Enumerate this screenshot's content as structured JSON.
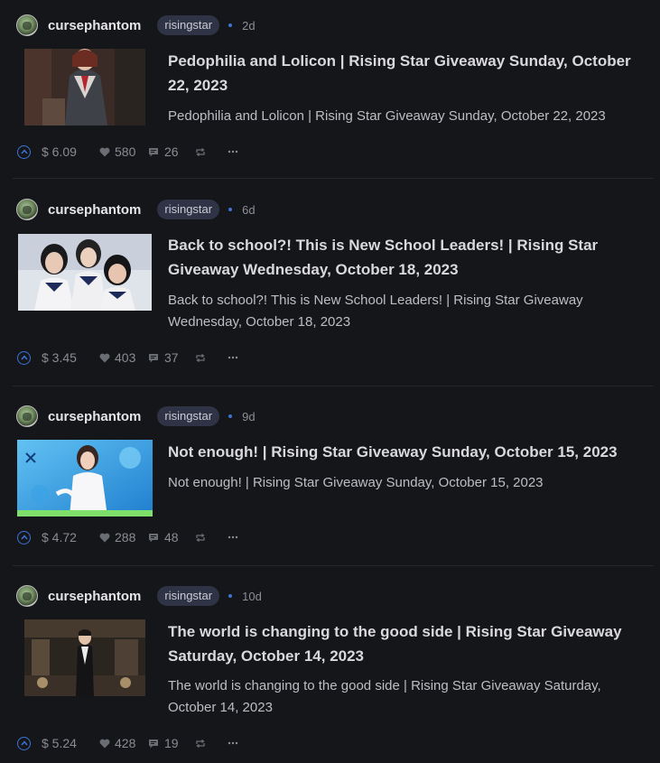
{
  "posts": [
    {
      "author": "cursephantom",
      "community": "risingstar",
      "age": "2d",
      "title": "Pedophilia and Lolicon | Rising Star Giveaway Sunday, October 22, 2023",
      "summary": "Pedophilia and Lolicon | Rising Star Giveaway Sunday, October 22, 2023",
      "payout": "$ 6.09",
      "votes": "580",
      "comments": "26"
    },
    {
      "author": "cursephantom",
      "community": "risingstar",
      "age": "6d",
      "title": "Back to school?! This is New School Leaders! | Rising Star Giveaway Wednesday, October 18, 2023",
      "summary": "Back to school?! This is New School Leaders! | Rising Star Giveaway Wednesday, October 18, 2023",
      "payout": "$ 3.45",
      "votes": "403",
      "comments": "37"
    },
    {
      "author": "cursephantom",
      "community": "risingstar",
      "age": "9d",
      "title": "Not enough! | Rising Star Giveaway Sunday, October 15, 2023",
      "summary": "Not enough! | Rising Star Giveaway Sunday, October 15, 2023",
      "payout": "$ 4.72",
      "votes": "288",
      "comments": "48"
    },
    {
      "author": "cursephantom",
      "community": "risingstar",
      "age": "10d",
      "title": "The world is changing to the good side | Rising Star Giveaway Saturday, October 14, 2023",
      "summary": "The world is changing to the good side | Rising Star Giveaway Saturday, October 14, 2023",
      "payout": "$ 5.24",
      "votes": "428",
      "comments": "19"
    }
  ],
  "icons": {
    "upvote": "upvote-icon",
    "heart": "heart-icon",
    "comment": "comment-icon",
    "reblog": "reblog-icon",
    "more": "more-icon"
  },
  "colors": {
    "background": "#15161a",
    "accent": "#3b74d6",
    "community_badge": "#2e3446"
  }
}
